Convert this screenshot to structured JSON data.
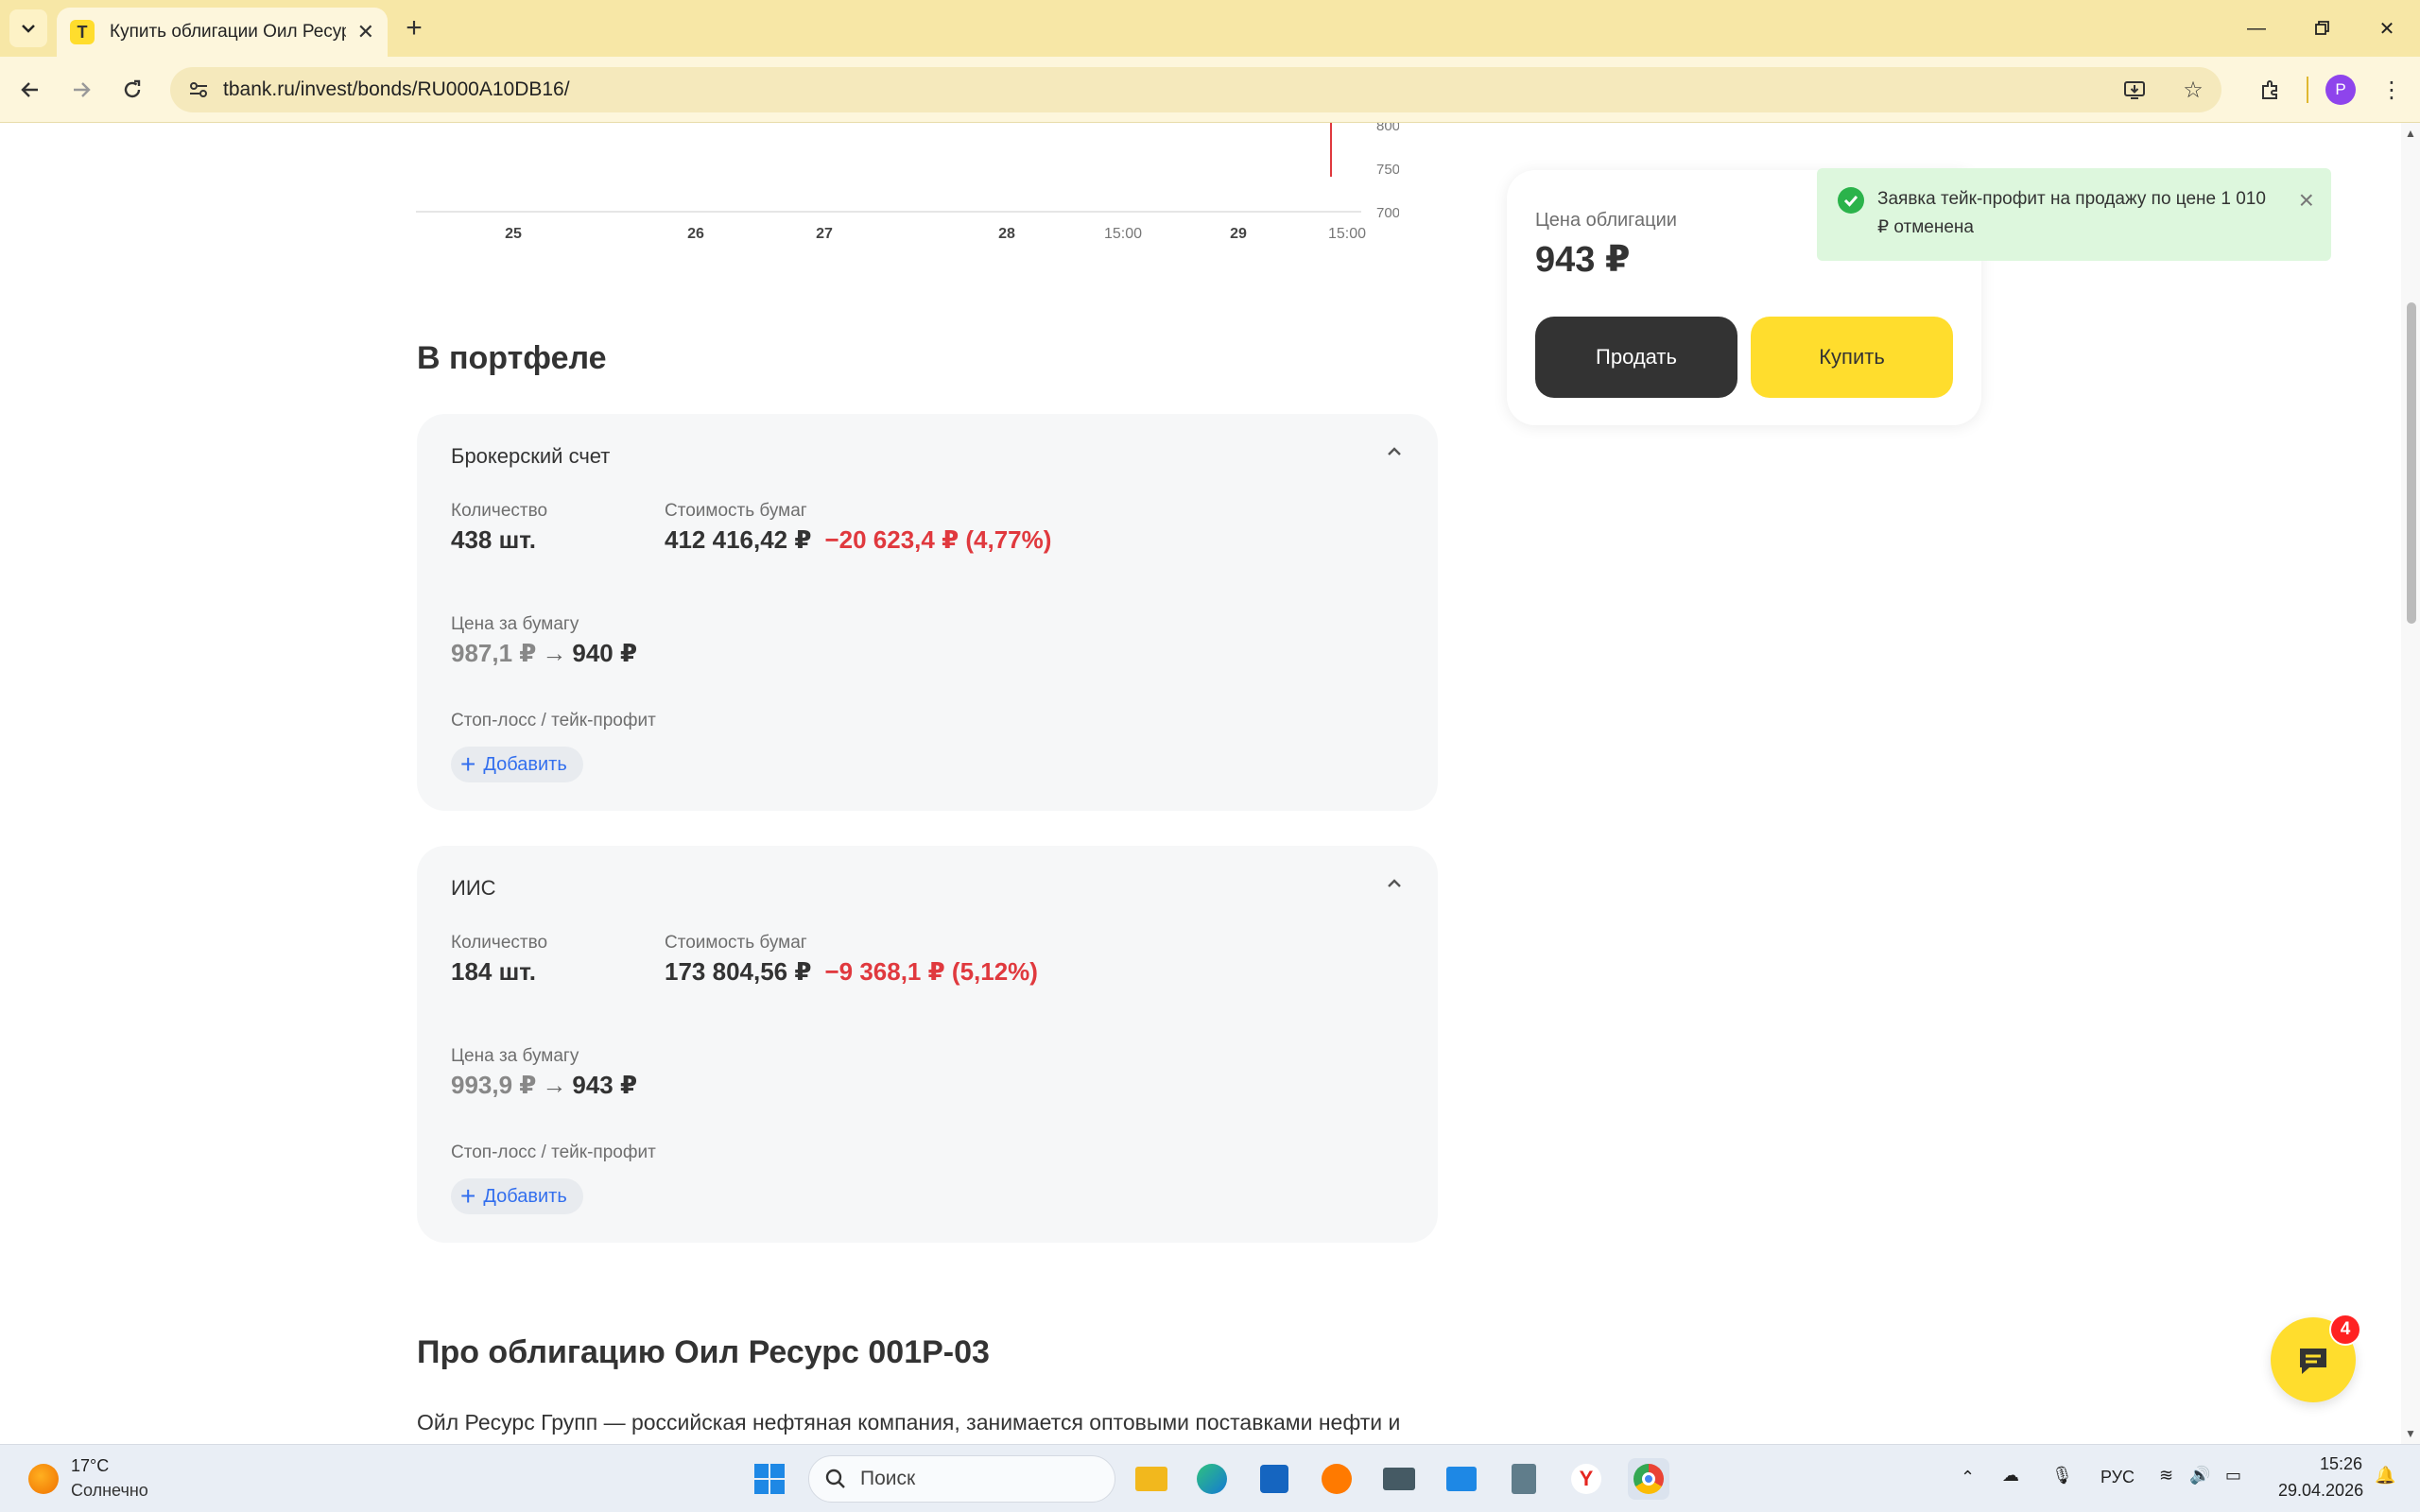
{
  "browser": {
    "tab_title": "Купить облигации Оил Ресурс",
    "favicon_letter": "T",
    "url": "tbank.ru/invest/bonds/RU000A10DB16/",
    "profile_initial": "P"
  },
  "chart": {
    "y_ticks": [
      "800,0",
      "750,0",
      "700,0"
    ],
    "x_ticks": [
      "25",
      "26",
      "27",
      "28",
      "15:00",
      "29",
      "15:00"
    ]
  },
  "portfolio": {
    "title": "В портфеле",
    "accounts": [
      {
        "name": "Брокерский счет",
        "qty_label": "Количество",
        "qty_value": "438 шт.",
        "cost_label": "Стоимость бумаг",
        "cost_value": "412 416,42 ₽",
        "cost_change": "−20 623,4 ₽ (4,77%)",
        "price_label": "Цена за бумагу",
        "price_old": "987,1 ₽",
        "price_new": "940 ₽",
        "sltp_label": "Стоп-лосс / тейк-профит",
        "add_label": "Добавить"
      },
      {
        "name": "ИИС",
        "qty_label": "Количество",
        "qty_value": "184 шт.",
        "cost_label": "Стоимость бумаг",
        "cost_value": "173 804,56 ₽",
        "cost_change": "−9 368,1 ₽ (5,12%)",
        "price_label": "Цена за бумагу",
        "price_old": "993,9 ₽",
        "price_new": "943 ₽",
        "sltp_label": "Стоп-лосс / тейк-профит",
        "add_label": "Добавить"
      }
    ]
  },
  "about": {
    "title": "Про облигацию Оил Ресурс 001Р-03",
    "text": "Ойл Ресурс Групп — российская нефтяная компания, занимается оптовыми поставками нефти и"
  },
  "trade_panel": {
    "price_label": "Цена облигации",
    "price_value": "943 ₽",
    "sell_label": "Продать",
    "buy_label": "Купить"
  },
  "toast": {
    "text": "Заявка тейк-профит на продажу по цене 1 010 ₽ отменена"
  },
  "chat": {
    "badge_count": "4"
  },
  "taskbar": {
    "weather_temp": "17°C",
    "weather_desc": "Солнечно",
    "search_label": "Поиск",
    "lang": "РУС",
    "time": "15:26",
    "date": "29.04.2026"
  },
  "colors": {
    "accent_yellow": "#ffdd2d",
    "negative_red": "#e0393e",
    "link_blue": "#336fee",
    "chrome_tabbar": "#f7e7a6"
  }
}
